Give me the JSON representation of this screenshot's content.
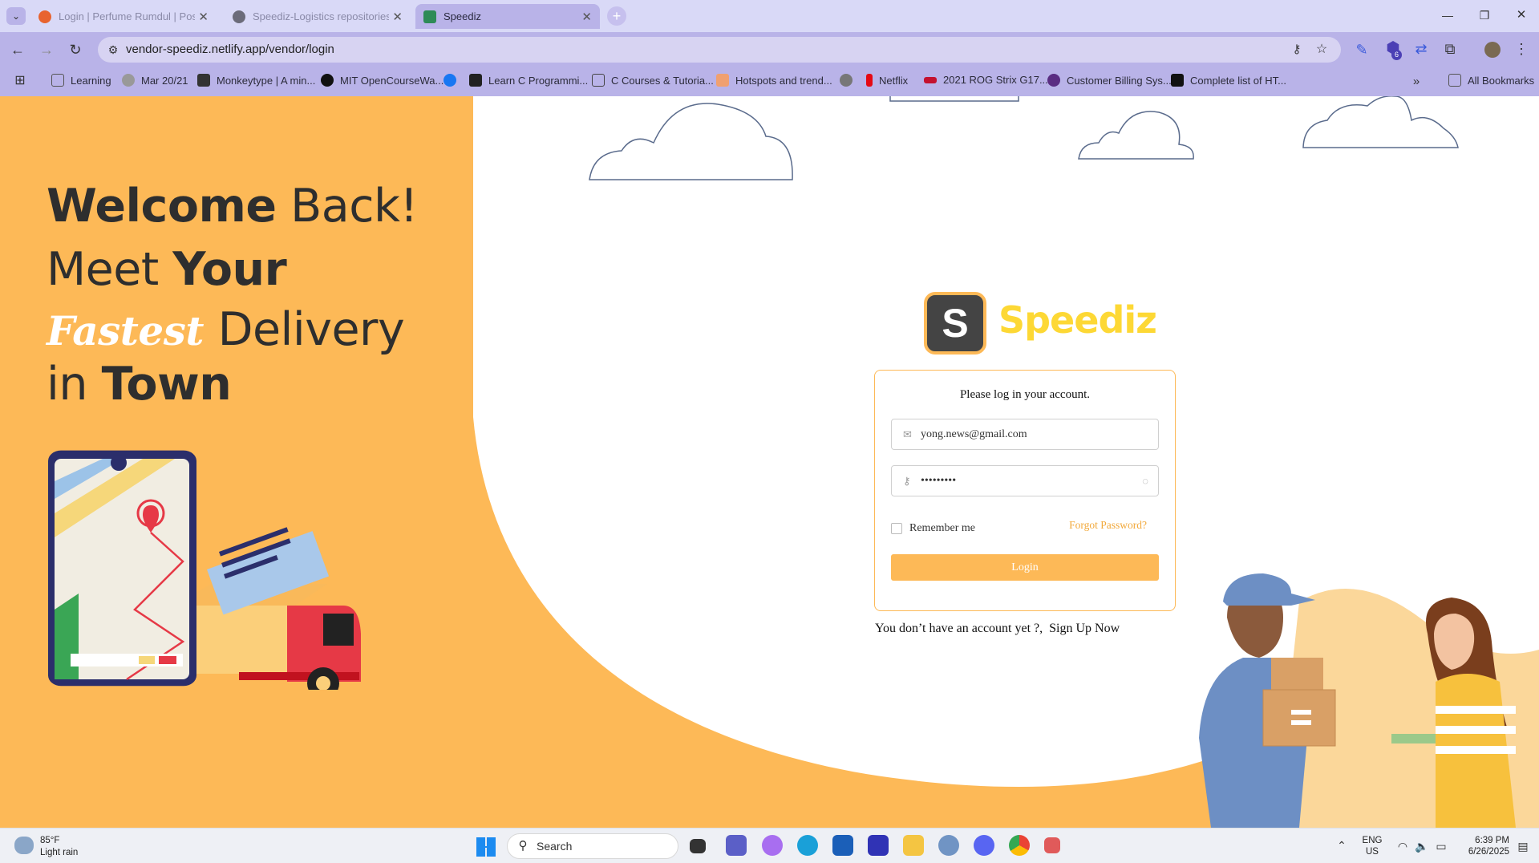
{
  "browser": {
    "tabs": [
      {
        "title": "Login | Perfume Rumdul | Postm",
        "color": "#e8632f"
      },
      {
        "title": "Speediz-Logistics repositories",
        "color": "#555555"
      },
      {
        "title": "Speediz",
        "color": "#2e8b57",
        "active": true
      }
    ],
    "url": "vendor-speediz.netlify.app/vendor/login",
    "bookmarks": [
      {
        "label": "Learning",
        "color": "#888888"
      },
      {
        "label": "Mar 20/21",
        "color": "#999999"
      },
      {
        "label": "Monkeytype | A min...",
        "color": "#333333"
      },
      {
        "label": "MIT OpenCourseWa...",
        "color": "#111111"
      },
      {
        "label": "",
        "color": "#1877f2"
      },
      {
        "label": "Learn C Programmi...",
        "color": "#222222"
      },
      {
        "label": "C Courses & Tutoria...",
        "color": "#444444"
      },
      {
        "label": "Hotspots and trend...",
        "color": "#e8632f"
      },
      {
        "label": "",
        "color": "#666666"
      },
      {
        "label": "Netflix",
        "color": "#e50914"
      },
      {
        "label": "2021 ROG Strix G17...",
        "color": "#c4122f"
      },
      {
        "label": "Customer Billing Sys...",
        "color": "#5a2d82"
      },
      {
        "label": "Complete list of HT...",
        "color": "#111111"
      }
    ],
    "all_bookmarks": "All Bookmarks",
    "extension_badge": "6"
  },
  "hero": {
    "welcome_bold": "Welcome",
    "welcome_rest": " Back!",
    "meet": "Meet ",
    "your": "Your",
    "fastest": "Fastest",
    "delivery": " Delivery",
    "in": "in ",
    "town": "Town"
  },
  "logo": {
    "letter": "S",
    "name": "Speediz"
  },
  "login": {
    "heading": "Please log in your account.",
    "email_value": "yong.news@gmail.com",
    "password_value": "•••••••••",
    "remember": "Remember me",
    "forgot": "Forgot Password?",
    "button": "Login",
    "no_account": "You don’t have an account yet ?,",
    "signup": "Sign Up Now"
  },
  "taskbar": {
    "weather_temp": "85°F",
    "weather_desc": "Light rain",
    "search": "Search",
    "lang": "ENG",
    "region": "US",
    "time": "6:39 PM",
    "date": "6/26/2025"
  },
  "colors": {
    "accent": "#fdb957",
    "logo_text": "#fdd835",
    "dark": "#444444"
  }
}
